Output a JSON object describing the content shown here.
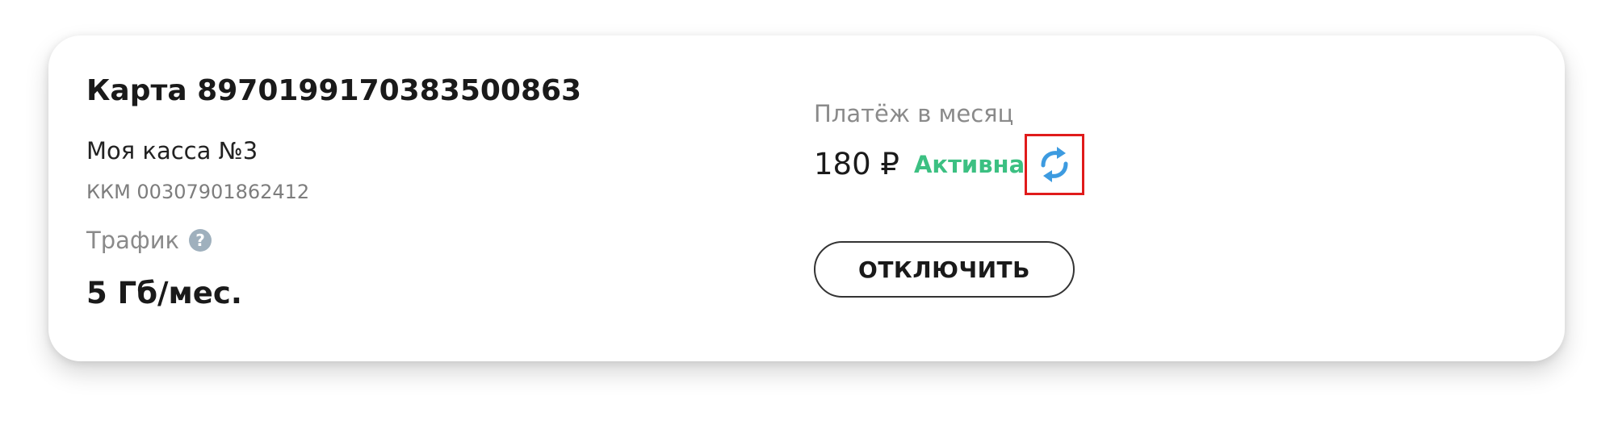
{
  "card": {
    "title": "Карта 8970199170383500863",
    "register_name": "Моя касса №3",
    "kkm": "ККМ 00307901862412",
    "traffic": {
      "label": "Трафик",
      "help_glyph": "?",
      "value": "5 Гб/мес."
    },
    "payment": {
      "label": "Платёж в месяц",
      "price": "180 ₽",
      "status": "Активна",
      "status_color": "#3cc082"
    },
    "refresh_icon": "refresh-icon",
    "disable_button_label": "ОТКЛЮЧИТЬ"
  },
  "colors": {
    "accent_blue": "#3d9be0",
    "highlight_red": "#e01b1b"
  }
}
